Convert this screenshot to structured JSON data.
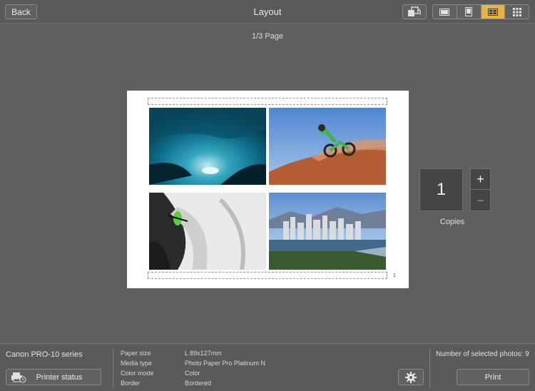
{
  "header": {
    "back_label": "Back",
    "title": "Layout",
    "rotate_icon": "rotate-icon",
    "layout_options": [
      {
        "icon": "single-landscape-icon",
        "active": false
      },
      {
        "icon": "single-portrait-icon",
        "active": false
      },
      {
        "icon": "four-up-grid-icon",
        "active": true
      },
      {
        "icon": "nine-up-grid-icon",
        "active": false
      }
    ],
    "accent_color": "#e7b33c"
  },
  "preview": {
    "page_indicator": "1/3 Page",
    "page_number": "1",
    "photos": [
      {
        "subject": "ice-cave-photo"
      },
      {
        "subject": "motocross-rider-photo"
      },
      {
        "subject": "kayak-waterfall-photo"
      },
      {
        "subject": "city-skyline-photo"
      }
    ]
  },
  "copies": {
    "value": "1",
    "plus": "+",
    "minus": "−",
    "label": "Copies"
  },
  "footer": {
    "printer_name": "Canon PRO-10 series",
    "printer_status_label": "Printer status",
    "settings": [
      {
        "key": "Paper size",
        "value": "L 89x127mm"
      },
      {
        "key": "Media type",
        "value": "Photo Paper Pro Platinum N"
      },
      {
        "key": "Color mode",
        "value": "Color"
      },
      {
        "key": "Border",
        "value": "Bordered"
      }
    ],
    "selected_photos": "Number of selected photos: 9",
    "print_label": "Print"
  }
}
